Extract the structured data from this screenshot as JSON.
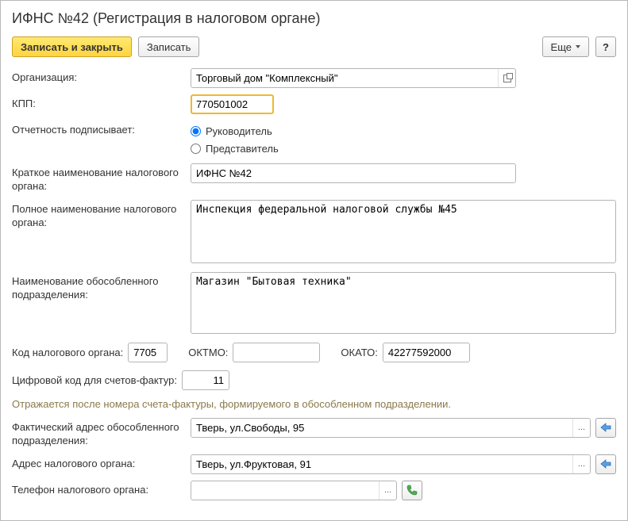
{
  "title": "ИФНС №42 (Регистрация в налоговом органе)",
  "toolbar": {
    "save_close": "Записать и закрыть",
    "save": "Записать",
    "more": "Еще",
    "help": "?"
  },
  "labels": {
    "organization": "Организация:",
    "kpp": "КПП:",
    "signed_by": "Отчетность подписывает:",
    "short_name": "Краткое наименование налогового органа:",
    "full_name": "Полное наименование налогового органа:",
    "unit_name": "Наименование обособленного подразделения:",
    "tax_code": "Код налогового органа:",
    "oktmo": "ОКТМО:",
    "okato": "ОКАТО:",
    "digit_code": "Цифровой код для счетов-фактур:",
    "actual_address": "Фактический адрес обособленного подразделения:",
    "tax_address": "Адрес налогового органа:",
    "tax_phone": "Телефон налогового органа:"
  },
  "radio": {
    "head": "Руководитель",
    "rep": "Представитель"
  },
  "values": {
    "organization": "Торговый дом \"Комплексный\"",
    "kpp": "770501002",
    "short_name": "ИФНС №42",
    "full_name": "Инспекция федеральной налоговой службы №45",
    "unit_name": "Магазин \"Бытовая техника\"",
    "tax_code": "7705",
    "oktmo": "",
    "okato": "42277592000",
    "digit_code": "11",
    "actual_address": "Тверь, ул.Свободы, 95",
    "tax_address": "Тверь, ул.Фруктовая, 91",
    "tax_phone": ""
  },
  "hint": "Отражается после номера счета-фактуры, формируемого в обособленном подразделении.",
  "icons": {
    "ellipsis": "...",
    "arrow_left": "⇦"
  }
}
